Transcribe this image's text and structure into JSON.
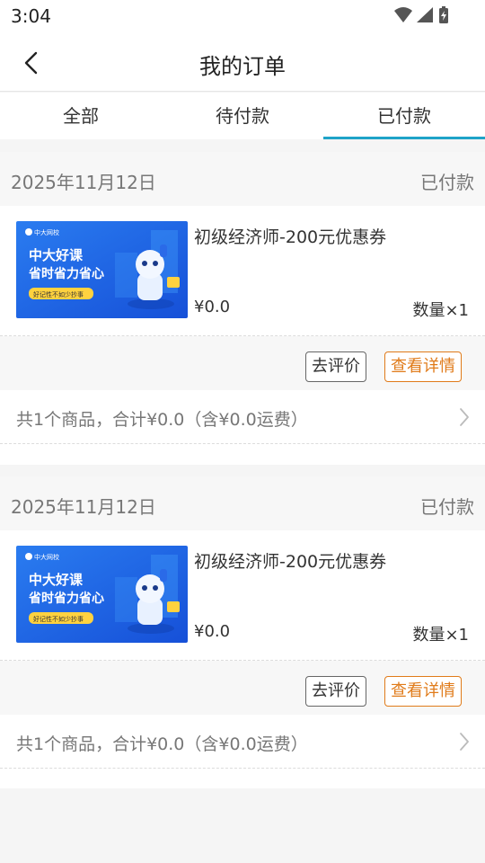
{
  "status_bar": {
    "time": "3:04",
    "icons": [
      "wifi-icon",
      "signal-icon",
      "battery-icon"
    ]
  },
  "header": {
    "title": "我的订单",
    "back_icon": "chevron-left-icon"
  },
  "tabs": [
    {
      "label": "全部",
      "active": false
    },
    {
      "label": "待付款",
      "active": false
    },
    {
      "label": "已付款",
      "active": true
    }
  ],
  "orders": [
    {
      "date": "2025年11月12日",
      "status": "已付款",
      "item": {
        "name": "初级经济师-200元优惠券",
        "price": "¥0.0",
        "quantity": "数量×1",
        "thumb": {
          "brand": "中大网校",
          "line1": "中大好课",
          "line2": "省时省力省心",
          "tag": "好记性不如少抄事"
        }
      },
      "actions": {
        "review": "去评价",
        "detail": "查看详情"
      },
      "summary": "共1个商品，合计¥0.0（含¥0.0运费）"
    },
    {
      "date": "2025年11月12日",
      "status": "已付款",
      "item": {
        "name": "初级经济师-200元优惠券",
        "price": "¥0.0",
        "quantity": "数量×1",
        "thumb": {
          "brand": "中大网校",
          "line1": "中大好课",
          "line2": "省时省力省心",
          "tag": "好记性不如少抄事"
        }
      },
      "actions": {
        "review": "去评价",
        "detail": "查看详情"
      },
      "summary": "共1个商品，合计¥0.0（含¥0.0运费）"
    }
  ],
  "colors": {
    "accent": "#1fa3c8",
    "detail_button": "#e07b1a",
    "thumb_bg": "#1f6fe0"
  }
}
